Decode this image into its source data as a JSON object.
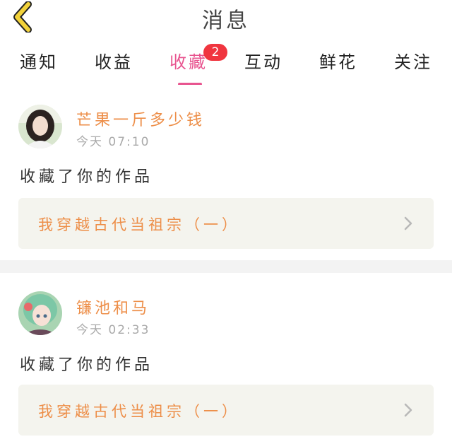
{
  "header": {
    "title": "消息"
  },
  "tabs": [
    {
      "label": "通知"
    },
    {
      "label": "收益"
    },
    {
      "label": "收藏",
      "badge": "2",
      "active": true
    },
    {
      "label": "互动"
    },
    {
      "label": "鲜花"
    },
    {
      "label": "关注"
    }
  ],
  "messages": [
    {
      "username": "芒果一斤多少钱",
      "time": "今天 07:10",
      "action": "收藏了你的作品",
      "work_title": "我穿越古代当祖宗（一）"
    },
    {
      "username": "镰池和马",
      "time": "今天 02:33",
      "action": "收藏了你的作品",
      "work_title": "我穿越古代当祖宗（一）"
    }
  ],
  "colors": {
    "accent_pink": "#e8548f",
    "username_orange": "#ed8e48",
    "badge_red": "#f0353f",
    "back_arrow": "#f2d23a"
  },
  "icons": [
    "back-arrow-icon",
    "chevron-right-icon"
  ]
}
